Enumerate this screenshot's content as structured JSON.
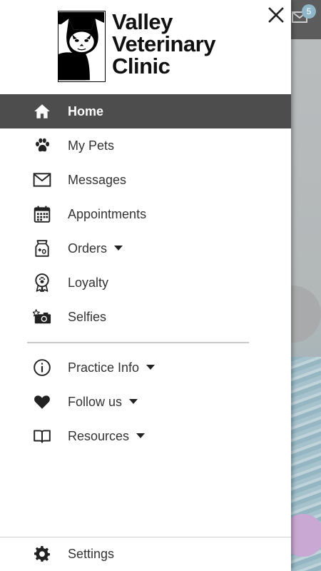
{
  "app": {
    "logo_lines": [
      "Valley",
      "Veterinary",
      "Clinic"
    ]
  },
  "background": {
    "mail_badge_count": "5"
  },
  "menu": {
    "primary": [
      {
        "label": "Home",
        "icon": "home-icon",
        "active": true
      },
      {
        "label": "My Pets",
        "icon": "paw-icon"
      },
      {
        "label": "Messages",
        "icon": "envelope-icon"
      },
      {
        "label": "Appointments",
        "icon": "calendar-icon"
      },
      {
        "label": "Orders",
        "icon": "food-bag-icon",
        "has_dropdown": true
      },
      {
        "label": "Loyalty",
        "icon": "ribbon-badge-icon"
      },
      {
        "label": "Selfies",
        "icon": "camera-star-icon"
      }
    ],
    "secondary": [
      {
        "label": "Practice Info",
        "icon": "info-icon",
        "has_dropdown": true
      },
      {
        "label": "Follow us",
        "icon": "heart-icon",
        "has_dropdown": true
      },
      {
        "label": "Resources",
        "icon": "book-icon",
        "has_dropdown": true
      }
    ],
    "settings_label": "Settings"
  },
  "colors": {
    "active_bg": "#4d4d4d",
    "drawer_bg": "#ffffff",
    "text": "#333333"
  }
}
